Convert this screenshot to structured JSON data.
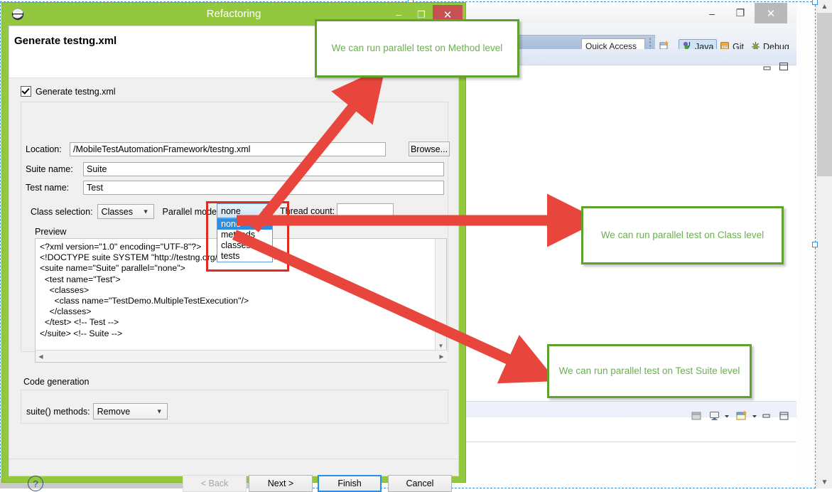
{
  "dialog": {
    "title": "Refactoring",
    "app_icon": "eclipse-icon",
    "heading": "Generate testng.xml",
    "window_buttons": {
      "minimize": "–",
      "maximize": "❐",
      "close": "✕"
    },
    "checkbox": {
      "label": "Generate testng.xml",
      "checked": true
    },
    "fields": {
      "location_label": "Location:",
      "location_value": "/MobileTestAutomationFramework/testng.xml",
      "browse_label": "Browse...",
      "suite_label": "Suite name:",
      "suite_value": "Suite",
      "test_label": "Test name:",
      "test_value": "Test",
      "class_selection_label": "Class selection:",
      "class_selection_value": "Classes",
      "parallel_mode_label": "Parallel mode:",
      "parallel_mode_value": "none",
      "parallel_mode_options": [
        "none",
        "methods",
        "classes",
        "tests"
      ],
      "parallel_mode_selected_index": 0,
      "thread_count_label": "Thread count:",
      "thread_count_value": ""
    },
    "preview": {
      "label": "Preview",
      "xml": "<?xml version=\"1.0\" encoding=\"UTF-8\"?>\n<!DOCTYPE suite SYSTEM \"http://testng.org/testng-1.0.dtd\">\n<suite name=\"Suite\" parallel=\"none\">\n  <test name=\"Test\">\n    <classes>\n      <class name=\"TestDemo.MultipleTestExecution\"/>\n    </classes>\n  </test> <!-- Test -->\n</suite> <!-- Suite -->"
    },
    "code_generation": {
      "group_label": "Code generation",
      "suite_methods_label": "suite() methods:",
      "suite_methods_value": "Remove"
    },
    "buttons": {
      "help": "?",
      "back": "< Back",
      "next": "Next >",
      "finish": "Finish",
      "cancel": "Cancel"
    },
    "accent_green": "#93c83e",
    "close_red": "#c75050",
    "focus_blue": "#2a8fe0"
  },
  "eclipse": {
    "window_buttons": {
      "minimize": "–",
      "maximize": "❐",
      "close": "✕"
    },
    "quick_access": "Quick Access",
    "perspectives": [
      {
        "icon": "open-perspective-icon",
        "label": ""
      },
      {
        "icon": "java-perspective-icon",
        "label": "Java",
        "active": true
      },
      {
        "icon": "git-perspective-icon",
        "label": "Git"
      },
      {
        "icon": "debug-perspective-icon",
        "label": "Debug"
      }
    ],
    "view_buttons": {
      "minimize": "minimize-icon",
      "maximize": "maximize-icon"
    },
    "lower_toolbar_icons": [
      "console-open-icon",
      "display-selected-console-icon",
      "console-dropdown-icon",
      "new-console-icon",
      "new-console-dropdown-icon",
      "minimize-icon",
      "maximize-icon"
    ]
  },
  "annotations": [
    {
      "id": "method",
      "text": "We can run parallel test on Method level",
      "border_color": "#5fa22e",
      "text_color": "#6ab04c"
    },
    {
      "id": "class",
      "text": "We can run parallel test on Class level",
      "border_color": "#5fa22e",
      "text_color": "#6ab04c"
    },
    {
      "id": "suite",
      "text": "We can run parallel test on Test Suite level",
      "border_color": "#5fa22e",
      "text_color": "#6ab04c"
    }
  ],
  "arrows": {
    "color": "#e8453c",
    "count": 3
  }
}
